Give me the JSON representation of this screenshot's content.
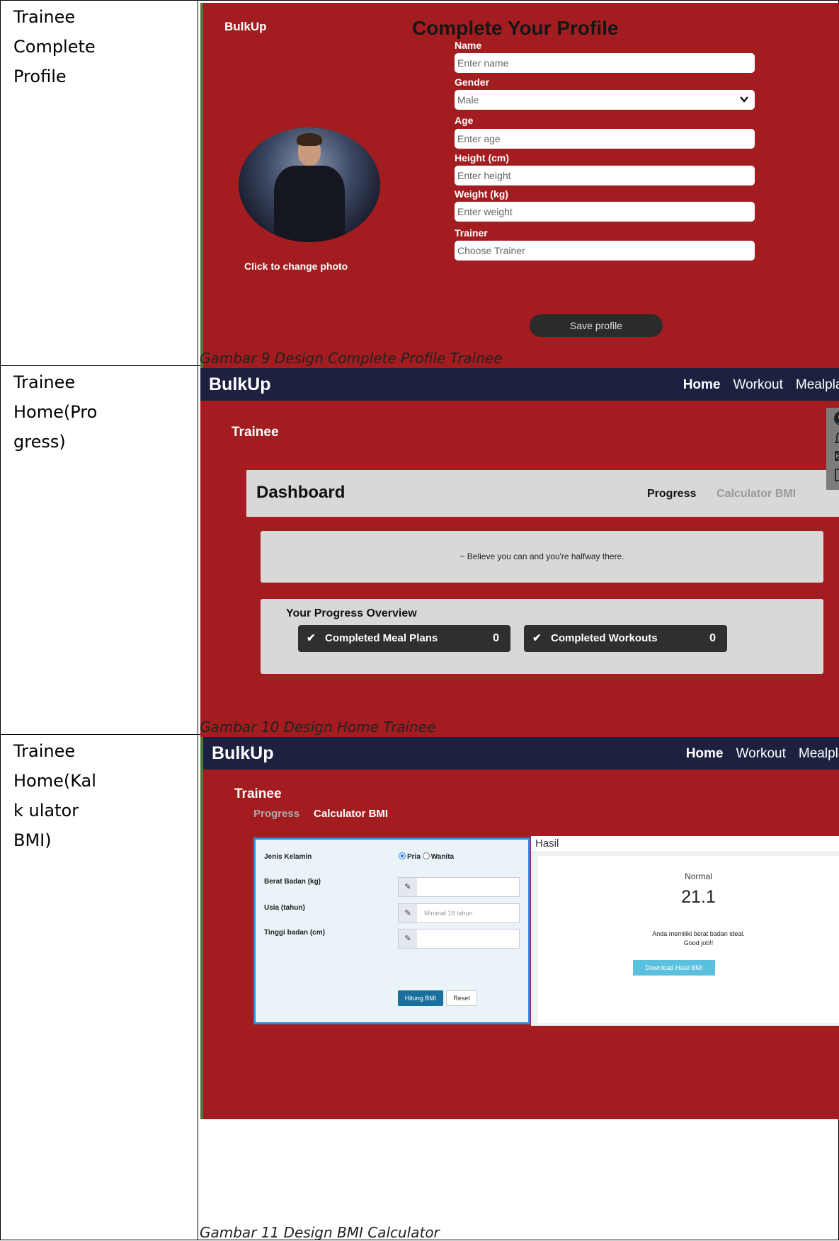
{
  "rows": [
    {
      "label": "Trainee\nComplete\nProfile",
      "caption": "Gambar 9 Design Complete Profile Trainee"
    },
    {
      "label": "Trainee\nHome(Pro\ngress)",
      "caption": "Gambar 10 Design Home Trainee"
    },
    {
      "label": "Trainee\nHome(Kal\nk ulator\nBMI)",
      "caption": "Gambar 11 Design BMI Calculator"
    }
  ],
  "profile": {
    "logo": "BulkUp",
    "title": "Complete Your Profile",
    "change_photo": "Click to change photo",
    "fields": [
      {
        "label": "Name",
        "placeholder": "Enter name"
      },
      {
        "label": "Gender",
        "value": "Male"
      },
      {
        "label": "Age",
        "placeholder": "Enter age"
      },
      {
        "label": "Height (cm)",
        "placeholder": "Enter height"
      },
      {
        "label": "Weight (kg)",
        "placeholder": "Enter weight"
      },
      {
        "label": "Trainer",
        "placeholder": "Choose Trainer"
      }
    ],
    "save_label": "Save profile"
  },
  "nav": {
    "logo": "BulkUp",
    "links": [
      "Home",
      "Workout",
      "Mealplan"
    ]
  },
  "home": {
    "role": "Trainee",
    "dashboard_title": "Dashboard",
    "tab_progress": "Progress",
    "tab_bmi": "Calculator BMI",
    "quote_icon": "~",
    "quote": "Believe you can and you're halfway there.",
    "overview_title": "Your Progress Overview",
    "cards": [
      {
        "label": "Completed Meal Plans",
        "count": "0"
      },
      {
        "label": "Completed Workouts",
        "count": "0"
      }
    ],
    "sidebar_icons": [
      "avatar",
      "bell-icon",
      "mail-icon",
      "logout-icon"
    ]
  },
  "bmi": {
    "role": "Trainee",
    "tab_progress": "Progress",
    "tab_bmi": "Calculator BMI",
    "gender_label": "Jenis Kelamin",
    "gender_options": [
      "Pria",
      "Wanita"
    ],
    "weight_label": "Berat Badan (kg)",
    "age_label": "Usia (tahun)",
    "age_placeholder": "Minimal 18 tahun",
    "height_label": "Tinggi badan (cm)",
    "calc_label": "Hitung BMI",
    "reset_label": "Reset",
    "result_title": "Hasil",
    "result_category": "Normal",
    "result_value": "21.1",
    "result_message": "Anda memiliki berat badan ideal.\nGood job!!",
    "download_label": "Download Hasil BMI"
  },
  "colors": {
    "brand_red": "#a31c1f",
    "navbar": "#1c2140",
    "panel_gray": "#d8d8d8",
    "accent_blue": "#2d8be0"
  }
}
